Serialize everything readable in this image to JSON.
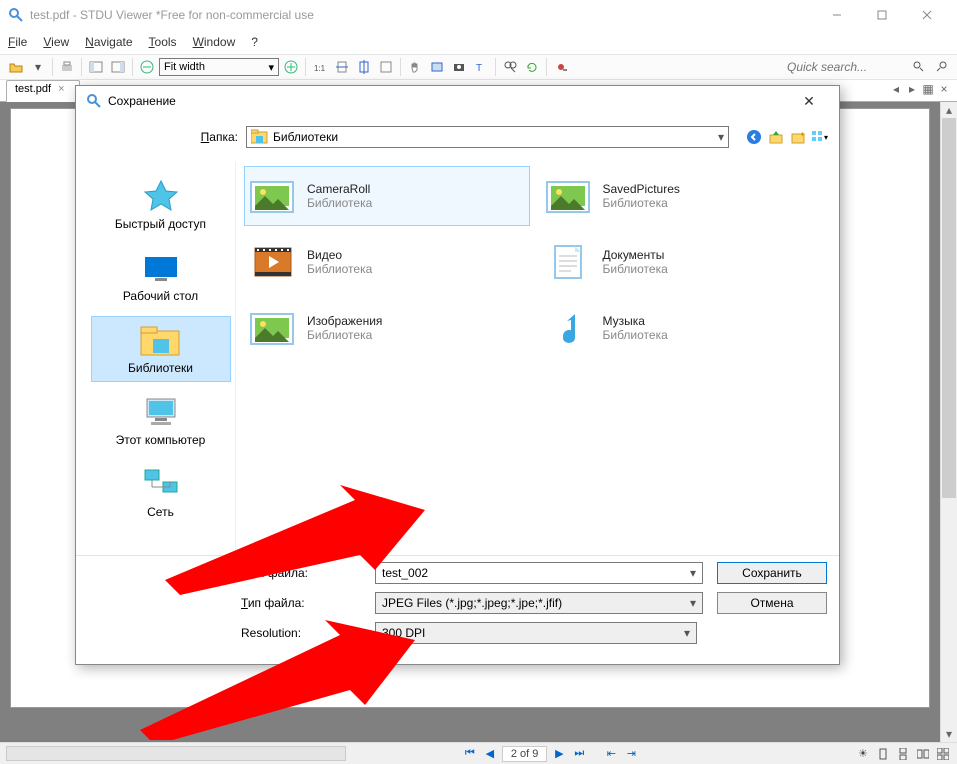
{
  "window": {
    "title": "test.pdf - STDU Viewer *Free for non-commercial use"
  },
  "menu": {
    "file": "File",
    "view": "View",
    "navigate": "Navigate",
    "tools": "Tools",
    "window": "Window",
    "help": "?"
  },
  "toolbar": {
    "zoom": "Fit width",
    "search_placeholder": "Quick search..."
  },
  "tabs": {
    "active": "test.pdf"
  },
  "status": {
    "page": "2 of 9"
  },
  "dialog": {
    "title": "Сохранение",
    "folder_label": "Папка:",
    "folder_value": "Библиотеки",
    "places": [
      {
        "label": "Быстрый доступ"
      },
      {
        "label": "Рабочий стол"
      },
      {
        "label": "Библиотеки"
      },
      {
        "label": "Этот компьютер"
      },
      {
        "label": "Сеть"
      }
    ],
    "libraries": [
      {
        "name": "CameraRoll",
        "sub": "Библиотека"
      },
      {
        "name": "SavedPictures",
        "sub": "Библиотека"
      },
      {
        "name": "Видео",
        "sub": "Библиотека"
      },
      {
        "name": "Документы",
        "sub": "Библиотека"
      },
      {
        "name": "Изображения",
        "sub": "Библиотека"
      },
      {
        "name": "Музыка",
        "sub": "Библиотека"
      }
    ],
    "filename_label": "Имя файла:",
    "filename_value": "test_002",
    "filetype_label": "Тип файла:",
    "filetype_value": "JPEG Files (*.jpg;*.jpeg;*.jpe;*.jfif)",
    "resolution_label": "Resolution:",
    "resolution_value": "300 DPI",
    "save": "Сохранить",
    "cancel": "Отмена"
  }
}
